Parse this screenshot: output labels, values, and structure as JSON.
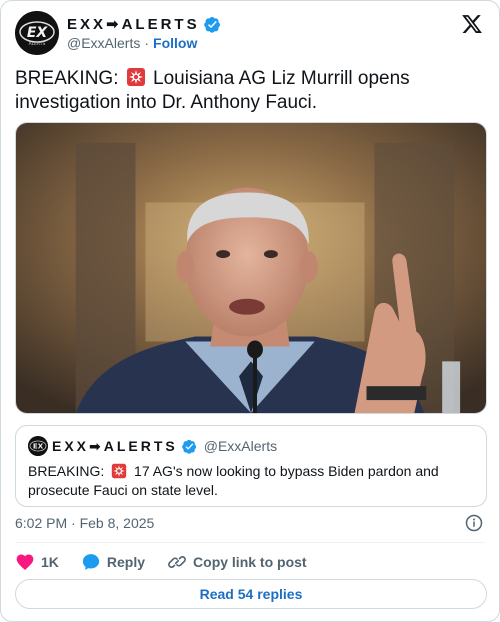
{
  "author": {
    "display_name": "EXX➡ALERTS",
    "handle": "@ExxAlerts",
    "separator": "·",
    "follow_label": "Follow"
  },
  "tweet": {
    "text_before": "BREAKING: ",
    "text_after": " Louisiana AG Liz Murrill opens investigation into Dr. Anthony Fauci."
  },
  "quote": {
    "display_name": "EXX➡ALERTS",
    "handle": "@ExxAlerts",
    "text_before": "BREAKING: ",
    "text_after": " 17 AG's now looking to bypass Biden pardon and prosecute Fauci on state level."
  },
  "meta": {
    "timestamp": "6:02 PM · Feb 8, 2025"
  },
  "actions": {
    "like_count": "1K",
    "reply_label": "Reply",
    "copy_label": "Copy link to post"
  },
  "footer": {
    "read_replies_label": "Read 54 replies"
  },
  "colors": {
    "accent": "#1d6fc4",
    "like": "#f91880",
    "verified": "#1d9bf0",
    "muted": "#536471"
  },
  "icons": {
    "header_logo": "x-logo-icon",
    "siren": "rotating-light-emoji",
    "info": "info-icon",
    "like": "heart-icon",
    "reply": "speech-bubble-icon",
    "copy": "link-icon"
  }
}
